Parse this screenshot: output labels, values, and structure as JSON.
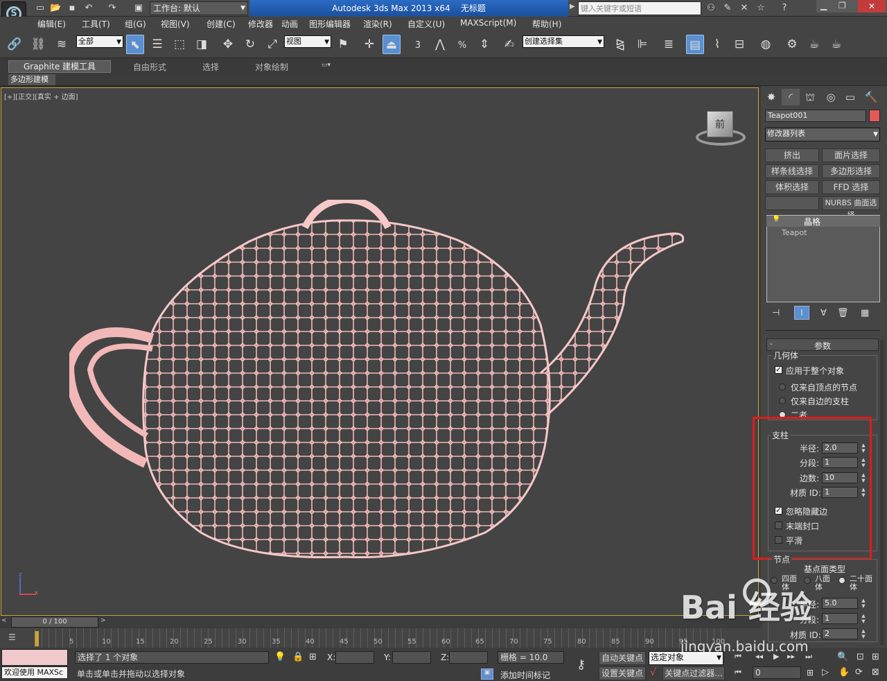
{
  "title_bar": {
    "workspace_label": "工作台: 默认",
    "app_title": "Autodesk 3ds Max  2013 x64",
    "doc_title": "无标题",
    "search_placeholder": "键入关键字或短语"
  },
  "menu": [
    "编辑(E)",
    "工具(T)",
    "组(G)",
    "视图(V)",
    "创建(C)",
    "修改器",
    "动画",
    "图形编辑器",
    "渲染(R)",
    "自定义(U)",
    "MAXScript(M)",
    "帮助(H)"
  ],
  "toolbar": {
    "selection_filter": "全部",
    "ref_coord": "视图",
    "named_selection": "创建选择集",
    "snap_angle": "3",
    "snap_percent": "%"
  },
  "ribbon": {
    "tabs": [
      "Graphite 建模工具",
      "自由形式",
      "选择",
      "对象绘制"
    ],
    "sub_tab": "多边形建模"
  },
  "viewport": {
    "label_plus": "[+]",
    "label_view": "[正交]",
    "label_mode": "[真实 + 边面]",
    "viewcube_label": "前"
  },
  "command_panel": {
    "object_name": "Teapot001",
    "object_color": "#e05a5a",
    "modifier_list": "修改器列表",
    "mod_buttons": [
      "挤出",
      "面片选择",
      "样条线选择",
      "多边形选择",
      "体积选择",
      "FFD 选择",
      "",
      "NURBS 曲面选择"
    ],
    "stack": [
      "晶格",
      "Teapot"
    ],
    "rollout_title": "参数",
    "geometry_group": "几何体",
    "apply_whole": "应用于整个对象",
    "radio_nodes": "仅来自顶点的节点",
    "radio_struts": "仅来自边的支柱",
    "radio_both": "二者",
    "struts_group": "支柱",
    "radius_label": "半径:",
    "radius_value": "2.0",
    "segments_label": "分段:",
    "segments_value": "1",
    "sides_label": "边数:",
    "sides_value": "10",
    "matid_label": "材质 ID:",
    "matid_value": "1",
    "ignore_hidden": "忽略隐藏边",
    "end_caps": "末端封口",
    "smooth": "平滑",
    "nodes_group": "节点",
    "base_type": "基点面类型",
    "tetra": "四面体",
    "octa": "八面体",
    "icosa": "二十面体",
    "node_radius_label": "半径:",
    "node_radius_value": "5.0",
    "node_seg_label": "分段:",
    "node_seg_value": "1",
    "node_matid_label": "材质 ID:",
    "node_matid_value": "2"
  },
  "timeline": {
    "frame": "0 / 100",
    "ticks": [
      "5",
      "10",
      "15",
      "20",
      "25",
      "30",
      "35",
      "40",
      "45",
      "50",
      "55",
      "60",
      "65",
      "70",
      "75",
      "80",
      "85",
      "90",
      "95",
      "100"
    ]
  },
  "status": {
    "maxscript": "欢迎使用 MAXSc",
    "selected": "选择了 1 个对象",
    "prompt": "单击或单击并拖动以选择对象",
    "x_label": "X:",
    "y_label": "Y:",
    "z_label": "Z:",
    "grid": "栅格 = 10.0",
    "add_time_tag": "添加时间标记",
    "auto_key": "自动关键点",
    "set_key": "设置关键点",
    "selected_object": "选定对象",
    "key_filters": "关键点过滤器...",
    "frame_value": "0"
  },
  "watermark": {
    "brand": "Bai  经验",
    "url": "jingyan.baidu.com"
  }
}
